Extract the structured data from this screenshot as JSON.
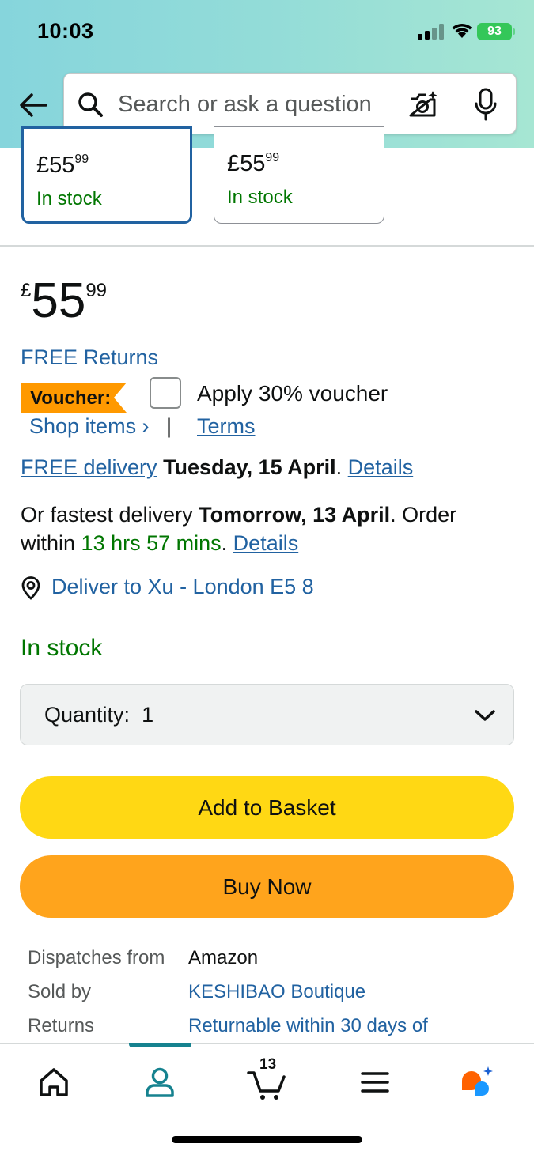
{
  "status_bar": {
    "time": "10:03",
    "battery": "93"
  },
  "search": {
    "placeholder": "Search or ask a question"
  },
  "variants": [
    {
      "price_whole": "£55",
      "price_frac": "99",
      "stock": "In stock",
      "selected": true
    },
    {
      "price_whole": "£55",
      "price_frac": "99",
      "stock": "In stock",
      "selected": false
    }
  ],
  "price": {
    "currency": "£",
    "whole": "55",
    "fraction": "99"
  },
  "free_returns": "FREE Returns",
  "voucher": {
    "badge": "Voucher:",
    "text": "Apply 30% voucher",
    "shop_items": "Shop items ›",
    "separator": "|",
    "terms": "Terms",
    "checked": false
  },
  "delivery": {
    "free_delivery_link": "FREE delivery",
    "free_delivery_date": "Tuesday, 15 April",
    "details": "Details",
    "fastest_prefix": "Or fastest delivery",
    "fastest_date": "Tomorrow, 13 April",
    "order_within_prefix": ". Order within",
    "countdown": "13 hrs 57 mins",
    "period": ".",
    "details2": "Details"
  },
  "deliver_to": "Deliver to Xu - London E5 8",
  "stock_status": "In stock",
  "quantity": {
    "label": "Quantity:",
    "value": "1"
  },
  "buttons": {
    "add_to_basket": "Add to Basket",
    "buy_now": "Buy Now"
  },
  "info": {
    "dispatches_from_key": "Dispatches from",
    "dispatches_from_val": "Amazon",
    "sold_by_key": "Sold by",
    "sold_by_val": "KESHIBAO Boutique",
    "returns_key": "Returns",
    "returns_val": "Returnable within 30 days of"
  },
  "bottom_nav": {
    "items": [
      "home-icon",
      "account-icon",
      "cart-icon",
      "menu-icon",
      "rufus-icon"
    ],
    "active": "account-icon",
    "cart_count": "13"
  },
  "colors": {
    "link": "#2162a1",
    "in_stock": "#007600",
    "basket_button": "#ffd814",
    "buy_button": "#ffa41c",
    "voucher_badge": "#ff9900",
    "active_nav": "#16828f"
  }
}
